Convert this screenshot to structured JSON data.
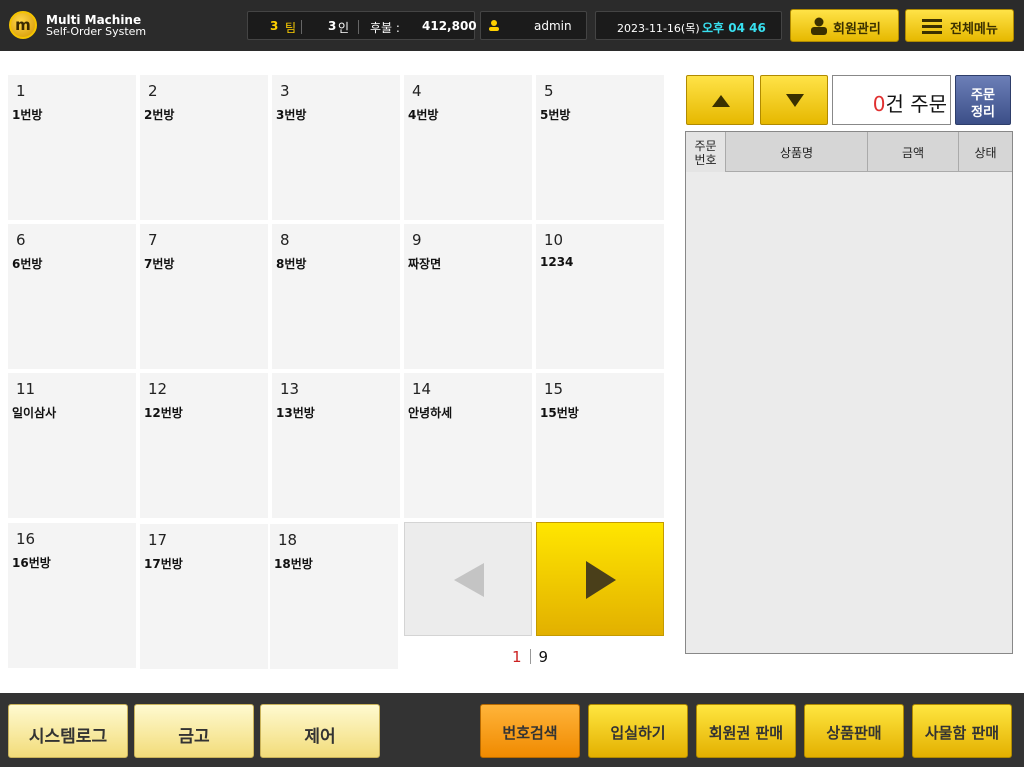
{
  "header": {
    "logo_letter": "m",
    "brand_line1": "Multi Machine",
    "brand_line2": "Self-Order System",
    "team_count": "3",
    "team_unit": "팀",
    "people_count": "3",
    "people_unit": "인",
    "deferred_label": "후불 :",
    "deferred_amount": "412,800",
    "user": "admin",
    "date": "2023-11-16(목)",
    "time": "오후 04 46",
    "member_button": "회원관리",
    "menu_button": "전체메뉴"
  },
  "rooms": [
    {
      "number": "1",
      "name": "1번방"
    },
    {
      "number": "2",
      "name": "2번방"
    },
    {
      "number": "3",
      "name": "3번방"
    },
    {
      "number": "4",
      "name": "4번방"
    },
    {
      "number": "5",
      "name": "5번방"
    },
    {
      "number": "6",
      "name": "6번방"
    },
    {
      "number": "7",
      "name": "7번방"
    },
    {
      "number": "8",
      "name": "8번방"
    },
    {
      "number": "9",
      "name": "짜장면"
    },
    {
      "number": "10",
      "name": "1234"
    },
    {
      "number": "11",
      "name": "일이삼사"
    },
    {
      "number": "12",
      "name": "12번방"
    },
    {
      "number": "13",
      "name": "13번방"
    },
    {
      "number": "14",
      "name": "안녕하세"
    },
    {
      "number": "15",
      "name": "15번방"
    },
    {
      "number": "16",
      "name": "16번방"
    },
    {
      "number": "17",
      "name": "17번방"
    },
    {
      "number": "18",
      "name": "18번방"
    }
  ],
  "pager": {
    "current": "1",
    "total": "9"
  },
  "orders": {
    "count": "0",
    "count_suffix": "건 주문",
    "sort_line1": "주문",
    "sort_line2": "정리",
    "columns": {
      "no_line1": "주문",
      "no_line2": "번호",
      "name": "상품명",
      "amount": "금액",
      "status": "상태"
    }
  },
  "footer": {
    "system_log": "시스템로그",
    "safe": "금고",
    "control": "제어",
    "number_search": "번호검색",
    "check_in": "입실하기",
    "membership_sale": "회원권 판매",
    "product_sale": "상품판매",
    "locker_sale": "사물함 판매"
  },
  "colors": {
    "accent_yellow": "#f5c400",
    "highlight_red": "#e03030",
    "sort_blue": "#4a5d96",
    "search_orange": "#f59a10"
  }
}
